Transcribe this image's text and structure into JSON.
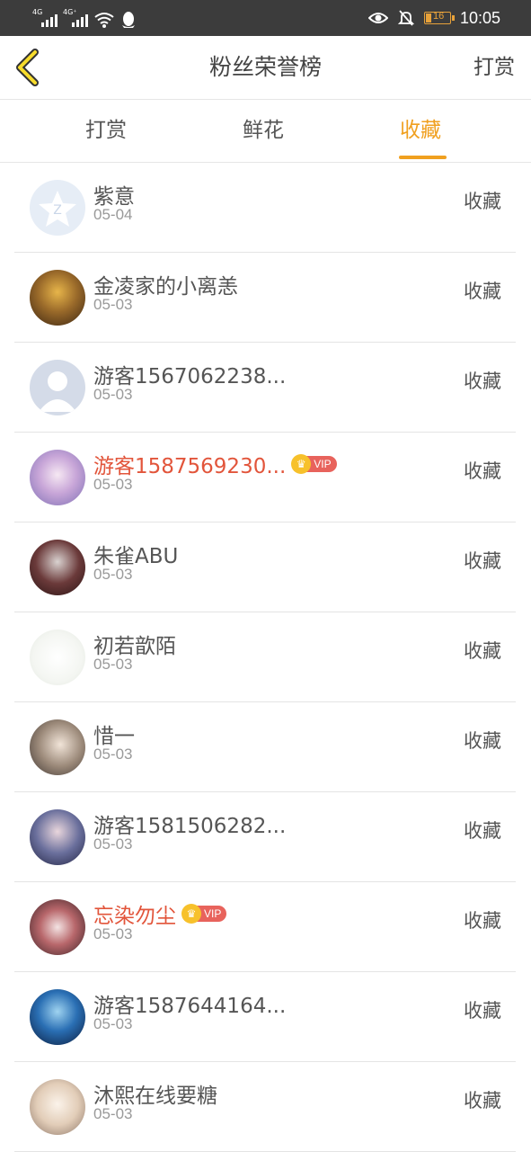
{
  "status_bar": {
    "signal1_tag": "4G",
    "signal2_tag": "4G⁺",
    "battery_level": "16",
    "time": "10:05",
    "icons": [
      "signal-icon",
      "signal-icon",
      "wifi-icon",
      "qq-icon",
      "eye-icon",
      "mute-bell-icon",
      "battery-icon"
    ]
  },
  "header": {
    "title": "粉丝荣誉榜",
    "right_action": "打赏",
    "back_icon": "chevron-left-icon"
  },
  "tabs": [
    {
      "label": "打赏",
      "active": false
    },
    {
      "label": "鲜花",
      "active": false
    },
    {
      "label": "收藏",
      "active": true
    }
  ],
  "colors": {
    "accent": "#f0a020",
    "vip_name": "#e2553b",
    "status_bar_bg": "#3c3c3c"
  },
  "fans": [
    {
      "name": "紫意",
      "date": "05-04",
      "action": "收藏",
      "vip": false,
      "vip_label": ""
    },
    {
      "name": "金凌家的小离恙",
      "date": "05-03",
      "action": "收藏",
      "vip": false,
      "vip_label": ""
    },
    {
      "name": "游客1567062238...",
      "date": "05-03",
      "action": "收藏",
      "vip": false,
      "vip_label": ""
    },
    {
      "name": "游客1587569230...",
      "date": "05-03",
      "action": "收藏",
      "vip": true,
      "vip_label": "VIP"
    },
    {
      "name": "朱雀ABU",
      "date": "05-03",
      "action": "收藏",
      "vip": false,
      "vip_label": ""
    },
    {
      "name": "初若歆陌",
      "date": "05-03",
      "action": "收藏",
      "vip": false,
      "vip_label": ""
    },
    {
      "name": "惜一",
      "date": "05-03",
      "action": "收藏",
      "vip": false,
      "vip_label": ""
    },
    {
      "name": "游客1581506282...",
      "date": "05-03",
      "action": "收藏",
      "vip": false,
      "vip_label": ""
    },
    {
      "name": "忘染勿尘",
      "date": "05-03",
      "action": "收藏",
      "vip": true,
      "vip_label": "VIP"
    },
    {
      "name": "游客1587644164...",
      "date": "05-03",
      "action": "收藏",
      "vip": false,
      "vip_label": ""
    },
    {
      "name": "沐熙在线要糖",
      "date": "05-03",
      "action": "收藏",
      "vip": false,
      "vip_label": ""
    }
  ]
}
